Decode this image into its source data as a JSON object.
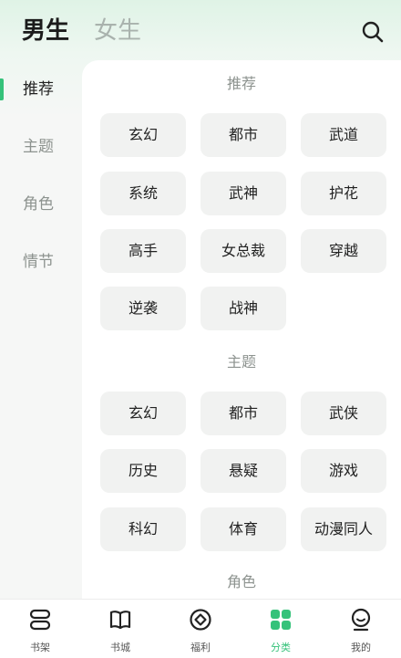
{
  "header": {
    "tabs": [
      {
        "label": "男生",
        "active": true
      },
      {
        "label": "女生",
        "active": false
      }
    ],
    "search_icon": "search-icon"
  },
  "sidebar": {
    "items": [
      {
        "label": "推荐",
        "active": true
      },
      {
        "label": "主题",
        "active": false
      },
      {
        "label": "角色",
        "active": false
      },
      {
        "label": "情节",
        "active": false
      }
    ]
  },
  "sections": [
    {
      "title": "推荐",
      "tags": [
        "玄幻",
        "都市",
        "武道",
        "系统",
        "武神",
        "护花",
        "高手",
        "女总裁",
        "穿越",
        "逆袭",
        "战神"
      ]
    },
    {
      "title": "主题",
      "tags": [
        "玄幻",
        "都市",
        "武侠",
        "历史",
        "悬疑",
        "游戏",
        "科幻",
        "体育",
        "动漫同人"
      ]
    },
    {
      "title": "角色",
      "tags": []
    }
  ],
  "bottom_nav": {
    "items": [
      {
        "label": "书架",
        "icon": "bookshelf-icon",
        "active": false
      },
      {
        "label": "书城",
        "icon": "book-icon",
        "active": false
      },
      {
        "label": "福利",
        "icon": "welfare-icon",
        "active": false
      },
      {
        "label": "分类",
        "icon": "category-grid-icon",
        "active": true
      },
      {
        "label": "我的",
        "icon": "profile-icon",
        "active": false
      }
    ]
  },
  "colors": {
    "accent": "#35c27a",
    "inactive_text": "#8d938f",
    "chip_bg": "#f1f2f1"
  }
}
